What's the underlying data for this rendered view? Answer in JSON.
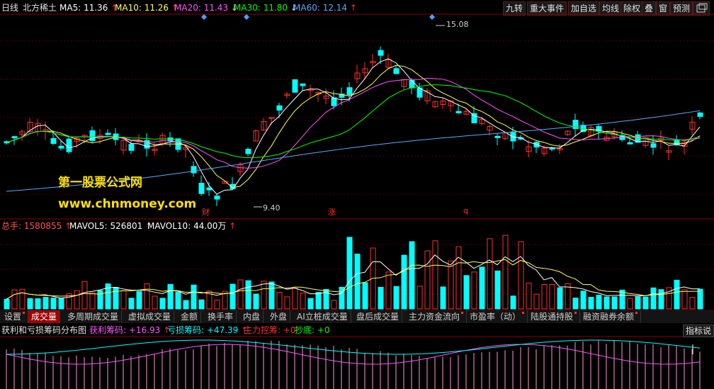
{
  "header": {
    "period": "日线",
    "stock": "北方稀土",
    "ma5": {
      "label": "MA5:",
      "value": "11.36",
      "dir": "↑"
    },
    "ma10": {
      "label": "MA10:",
      "value": "11.26",
      "dir": "↑"
    },
    "ma20": {
      "label": "MA20:",
      "value": "11.43",
      "dir": "↓"
    },
    "ma30": {
      "label": "MA30:",
      "value": "11.80",
      "dir": "↓"
    },
    "ma60": {
      "label": "MA60:",
      "value": "12.14",
      "dir": "↑"
    }
  },
  "toolbar": {
    "jiuzhuan": "九转",
    "events": "重大事件",
    "add_watch": "加自选",
    "ma_line": "均线",
    "exright": "除权",
    "overlay": "叠",
    "window": "窗",
    "forecast": "预测"
  },
  "price_chart": {
    "high_label": "15.08",
    "low_label": "9.40",
    "marks": [
      "财",
      "涨",
      "q"
    ],
    "colors": {
      "ma5": "#ffffff",
      "ma10": "#ffff55",
      "ma20": "#ff55ff",
      "ma30": "#00ff00",
      "ma60": "#55aaff",
      "up": "#ff3030",
      "down": "#00ffff"
    }
  },
  "watermark": {
    "line1": "第一股票公式网",
    "line2": "www.chnmoney.com"
  },
  "volume_header": {
    "total": {
      "label": "总手:",
      "value": "1580855",
      "dir": "↑"
    },
    "mavol5": {
      "label": "MAVOL5:",
      "value": "526801",
      "dir": "↑"
    },
    "mavol10": {
      "label": "MAVOL10:",
      "value": "44.00万",
      "dir": "↑"
    }
  },
  "tabs": [
    {
      "label": "设置",
      "active": false,
      "dot": true
    },
    {
      "label": "成交量",
      "active": true,
      "dot": false
    },
    {
      "label": "多周期成交量",
      "active": false,
      "dot": false
    },
    {
      "label": "虚拟成交量",
      "active": false,
      "dot": false
    },
    {
      "label": "金额",
      "active": false,
      "dot": false
    },
    {
      "label": "换手率",
      "active": false,
      "dot": false
    },
    {
      "label": "内盘",
      "active": false,
      "dot": false
    },
    {
      "label": "外盘",
      "active": false,
      "dot": false
    },
    {
      "label": "AI立桩成交量",
      "active": false,
      "dot": false
    },
    {
      "label": "盘后成交量",
      "active": false,
      "dot": false
    },
    {
      "label": "主力资金流向",
      "active": false,
      "dot": true
    },
    {
      "label": "市盈率（动）",
      "active": false,
      "dot": true
    },
    {
      "label": "陆股通持股",
      "active": false,
      "dot": true
    },
    {
      "label": "融资融券余额",
      "active": false,
      "dot": true
    }
  ],
  "indicator_header": {
    "name": "获利和亏损筹码分布图",
    "profit": {
      "label": "获利筹码:",
      "value": "+16.93",
      "dir": "↑"
    },
    "loss": {
      "label": "亏损筹码:",
      "value": "+47.39",
      "dir": "↑"
    },
    "main": {
      "label": "主力控筹:",
      "value": "+0"
    },
    "bottom": {
      "label": "抄底:",
      "value": "+0"
    },
    "button": "指标说"
  }
}
